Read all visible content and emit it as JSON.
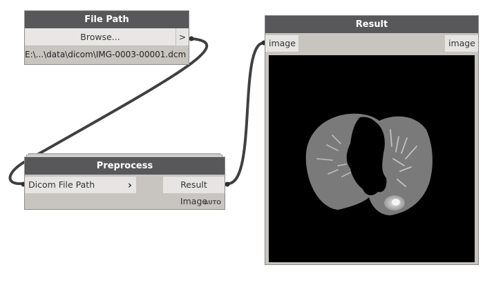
{
  "nodes": {
    "file_path": {
      "title": "File Path",
      "browse_label": "Browse...",
      "output_port": ">",
      "path_value": "E:\\...\\data\\dicom\\IMG-0003-00001.dcm"
    },
    "preprocess": {
      "title": "Preprocess",
      "input_port": "Dicom File Path",
      "input_arrow": "›",
      "output_port": "Result Image",
      "lacing": "AUTO"
    },
    "result": {
      "title": "Result",
      "input_port": "image",
      "output_port": "image"
    }
  },
  "colors": {
    "node_header": "#58585a",
    "node_body": "#c8c5c0",
    "port_bg": "#e6e5e3",
    "wire": "#404040",
    "preview_bg": "#000000"
  }
}
